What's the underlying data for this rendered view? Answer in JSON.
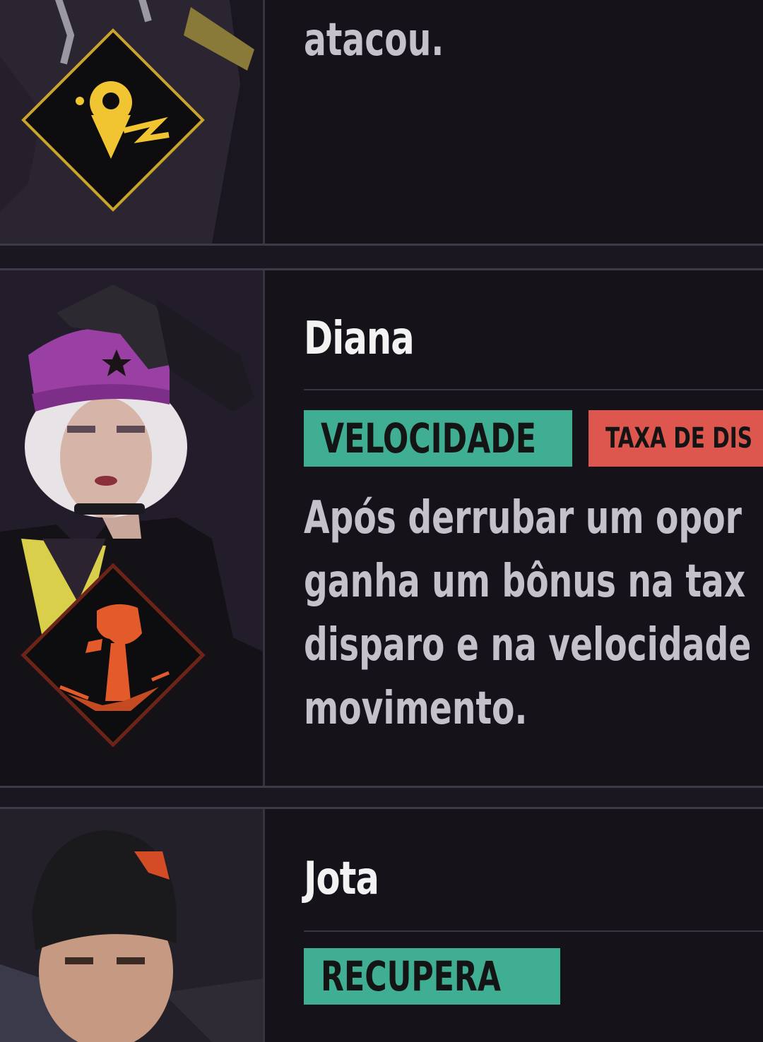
{
  "cards": [
    {
      "name": "",
      "description_lines": [
        "atacou."
      ],
      "skill_icon": "location-pin-lightning-icon",
      "skill_icon_color": "#f1c532"
    },
    {
      "name": "Diana",
      "tags": [
        {
          "label": "VELOCIDADE",
          "color": "#3fae93"
        },
        {
          "label": "TAXA DE DIS",
          "color": "#dd574f"
        }
      ],
      "description_lines": [
        "Após derrubar um opor",
        "ganha um bônus na tax",
        "disparo e na velocidade",
        "movimento."
      ],
      "skill_icon": "raised-fist-icon",
      "skill_icon_color": "#e35b2a"
    },
    {
      "name": "Jota",
      "tags": [
        {
          "label": "RECUPERA",
          "color": "#3fae93"
        }
      ],
      "description_lines": []
    }
  ]
}
